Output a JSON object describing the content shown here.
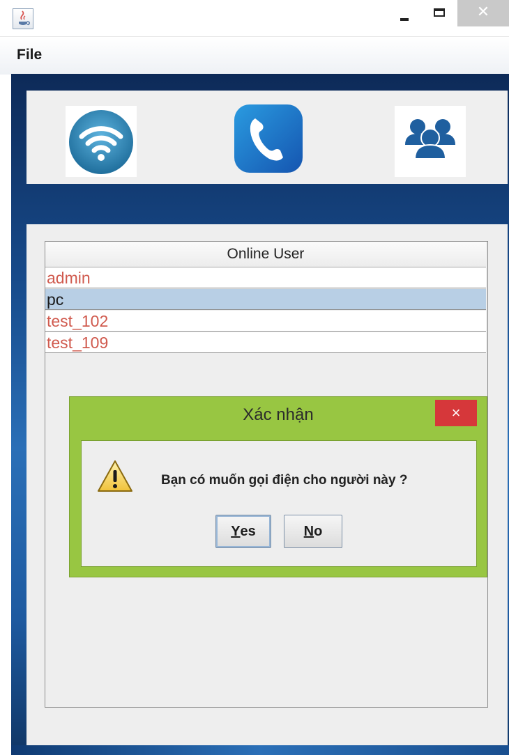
{
  "window": {
    "close_glyph": "✕"
  },
  "menu": {
    "file_label": "File"
  },
  "toolbar": {
    "icons": [
      "wifi-icon",
      "phone-icon",
      "users-icon"
    ],
    "colors": {
      "wifi": "#2f86b5",
      "phone": "#1e78c8",
      "users": "#1f5f9f"
    }
  },
  "user_list": {
    "header": "Online User",
    "rows": [
      {
        "name": "admin",
        "selected": false
      },
      {
        "name": "pc",
        "selected": true
      },
      {
        "name": "test_102",
        "selected": false
      },
      {
        "name": "test_109",
        "selected": false
      }
    ]
  },
  "dialog": {
    "title": "Xác nhận",
    "close_glyph": "×",
    "message": "Bạn có muốn gọi điện cho người này ?",
    "yes_mnemonic": "Y",
    "yes_rest": "es",
    "no_mnemonic": "N",
    "no_rest": "o",
    "accent_color": "#98c642",
    "close_color": "#d6373a"
  }
}
